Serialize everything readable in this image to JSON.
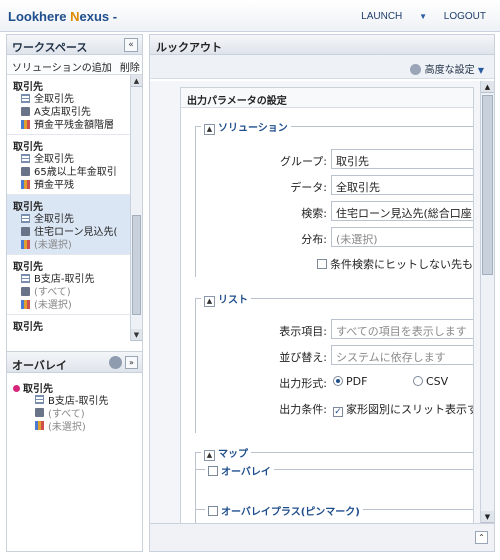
{
  "header": {
    "app_title_pre": "Lookhere ",
    "app_title_accent": "N",
    "app_title_post": "exus -",
    "launch_label": "LAUNCH",
    "logout_label": "LOGOUT"
  },
  "workspace": {
    "title": "ワークスペース",
    "collapse_symbol": "«",
    "toolbar": [
      "ソリューションの追加",
      "削除"
    ],
    "items": [
      {
        "name": "取引先",
        "layer": "全取引先",
        "filter": "A支店取引先",
        "category": "預金平残金額階層"
      },
      {
        "name": "取引先",
        "layer": "全取引先",
        "filter": "65歳以上年金取引",
        "category": "預金平残"
      },
      {
        "name": "取引先",
        "layer": "全取引先",
        "filter": "住宅ローン見込先(",
        "category": "(未選択)"
      },
      {
        "name": "取引先",
        "layer": "B支店-取引先",
        "filter": "(すべて)",
        "category": "(未選択)"
      },
      {
        "name": "取引先",
        "layer": "",
        "filter": "",
        "category": ""
      }
    ]
  },
  "overlay": {
    "title": "オーバレイ",
    "name": "取引先",
    "layer": "B支店-取引先",
    "filter": "(すべて)",
    "category": "(未選択)"
  },
  "lookout": {
    "title": "ルックアウト",
    "advanced_label": "高度な設定",
    "params_title": "出力パラメータの設定",
    "solution_section": "ソリューション",
    "group_label": "グループ:",
    "group_value": "取引先",
    "data_label": "データ:",
    "data_value": "全取引先",
    "search_label": "検索:",
    "search_value": "住宅ローン見込先(総合口座",
    "dist_label": "分布:",
    "dist_value": "(未選択)",
    "no_hit_label": "条件検索にヒットしない先も",
    "list_section": "リスト",
    "display_label": "表示項目:",
    "display_value": "すべての項目を表示します",
    "sort_label": "並び替え:",
    "sort_value": "システムに依存します",
    "format_label": "出力形式:",
    "format_pdf": "PDF",
    "format_csv": "CSV",
    "cond_label": "出力条件:",
    "cond_value": "家形図別にスリット表示す",
    "map_section": "マップ",
    "overlay_option": "オーバレイ",
    "overlay_plus_option": "オーバレイプラス(ピンマーク)"
  },
  "icons": {
    "collapse": "«",
    "expand": "»",
    "toggle": "▲",
    "up": "▲",
    "down": "▼"
  }
}
